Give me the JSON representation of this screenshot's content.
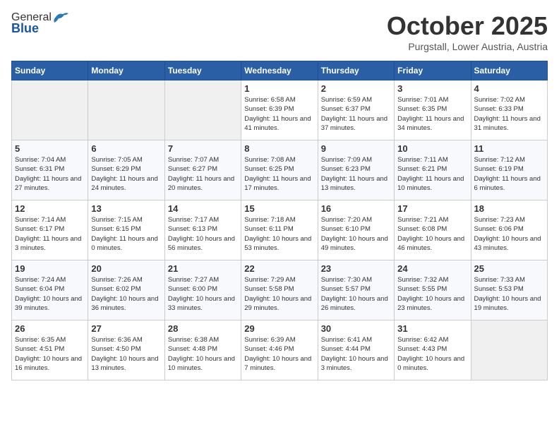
{
  "header": {
    "logo_general": "General",
    "logo_blue": "Blue",
    "title": "October 2025",
    "subtitle": "Purgstall, Lower Austria, Austria"
  },
  "calendar": {
    "days_of_week": [
      "Sunday",
      "Monday",
      "Tuesday",
      "Wednesday",
      "Thursday",
      "Friday",
      "Saturday"
    ],
    "weeks": [
      [
        {
          "day": "",
          "info": ""
        },
        {
          "day": "",
          "info": ""
        },
        {
          "day": "",
          "info": ""
        },
        {
          "day": "1",
          "info": "Sunrise: 6:58 AM\nSunset: 6:39 PM\nDaylight: 11 hours\nand 41 minutes."
        },
        {
          "day": "2",
          "info": "Sunrise: 6:59 AM\nSunset: 6:37 PM\nDaylight: 11 hours\nand 37 minutes."
        },
        {
          "day": "3",
          "info": "Sunrise: 7:01 AM\nSunset: 6:35 PM\nDaylight: 11 hours\nand 34 minutes."
        },
        {
          "day": "4",
          "info": "Sunrise: 7:02 AM\nSunset: 6:33 PM\nDaylight: 11 hours\nand 31 minutes."
        }
      ],
      [
        {
          "day": "5",
          "info": "Sunrise: 7:04 AM\nSunset: 6:31 PM\nDaylight: 11 hours\nand 27 minutes."
        },
        {
          "day": "6",
          "info": "Sunrise: 7:05 AM\nSunset: 6:29 PM\nDaylight: 11 hours\nand 24 minutes."
        },
        {
          "day": "7",
          "info": "Sunrise: 7:07 AM\nSunset: 6:27 PM\nDaylight: 11 hours\nand 20 minutes."
        },
        {
          "day": "8",
          "info": "Sunrise: 7:08 AM\nSunset: 6:25 PM\nDaylight: 11 hours\nand 17 minutes."
        },
        {
          "day": "9",
          "info": "Sunrise: 7:09 AM\nSunset: 6:23 PM\nDaylight: 11 hours\nand 13 minutes."
        },
        {
          "day": "10",
          "info": "Sunrise: 7:11 AM\nSunset: 6:21 PM\nDaylight: 11 hours\nand 10 minutes."
        },
        {
          "day": "11",
          "info": "Sunrise: 7:12 AM\nSunset: 6:19 PM\nDaylight: 11 hours\nand 6 minutes."
        }
      ],
      [
        {
          "day": "12",
          "info": "Sunrise: 7:14 AM\nSunset: 6:17 PM\nDaylight: 11 hours\nand 3 minutes."
        },
        {
          "day": "13",
          "info": "Sunrise: 7:15 AM\nSunset: 6:15 PM\nDaylight: 11 hours\nand 0 minutes."
        },
        {
          "day": "14",
          "info": "Sunrise: 7:17 AM\nSunset: 6:13 PM\nDaylight: 10 hours\nand 56 minutes."
        },
        {
          "day": "15",
          "info": "Sunrise: 7:18 AM\nSunset: 6:11 PM\nDaylight: 10 hours\nand 53 minutes."
        },
        {
          "day": "16",
          "info": "Sunrise: 7:20 AM\nSunset: 6:10 PM\nDaylight: 10 hours\nand 49 minutes."
        },
        {
          "day": "17",
          "info": "Sunrise: 7:21 AM\nSunset: 6:08 PM\nDaylight: 10 hours\nand 46 minutes."
        },
        {
          "day": "18",
          "info": "Sunrise: 7:23 AM\nSunset: 6:06 PM\nDaylight: 10 hours\nand 43 minutes."
        }
      ],
      [
        {
          "day": "19",
          "info": "Sunrise: 7:24 AM\nSunset: 6:04 PM\nDaylight: 10 hours\nand 39 minutes."
        },
        {
          "day": "20",
          "info": "Sunrise: 7:26 AM\nSunset: 6:02 PM\nDaylight: 10 hours\nand 36 minutes."
        },
        {
          "day": "21",
          "info": "Sunrise: 7:27 AM\nSunset: 6:00 PM\nDaylight: 10 hours\nand 33 minutes."
        },
        {
          "day": "22",
          "info": "Sunrise: 7:29 AM\nSunset: 5:58 PM\nDaylight: 10 hours\nand 29 minutes."
        },
        {
          "day": "23",
          "info": "Sunrise: 7:30 AM\nSunset: 5:57 PM\nDaylight: 10 hours\nand 26 minutes."
        },
        {
          "day": "24",
          "info": "Sunrise: 7:32 AM\nSunset: 5:55 PM\nDaylight: 10 hours\nand 23 minutes."
        },
        {
          "day": "25",
          "info": "Sunrise: 7:33 AM\nSunset: 5:53 PM\nDaylight: 10 hours\nand 19 minutes."
        }
      ],
      [
        {
          "day": "26",
          "info": "Sunrise: 6:35 AM\nSunset: 4:51 PM\nDaylight: 10 hours\nand 16 minutes."
        },
        {
          "day": "27",
          "info": "Sunrise: 6:36 AM\nSunset: 4:50 PM\nDaylight: 10 hours\nand 13 minutes."
        },
        {
          "day": "28",
          "info": "Sunrise: 6:38 AM\nSunset: 4:48 PM\nDaylight: 10 hours\nand 10 minutes."
        },
        {
          "day": "29",
          "info": "Sunrise: 6:39 AM\nSunset: 4:46 PM\nDaylight: 10 hours\nand 7 minutes."
        },
        {
          "day": "30",
          "info": "Sunrise: 6:41 AM\nSunset: 4:44 PM\nDaylight: 10 hours\nand 3 minutes."
        },
        {
          "day": "31",
          "info": "Sunrise: 6:42 AM\nSunset: 4:43 PM\nDaylight: 10 hours\nand 0 minutes."
        },
        {
          "day": "",
          "info": ""
        }
      ]
    ]
  }
}
